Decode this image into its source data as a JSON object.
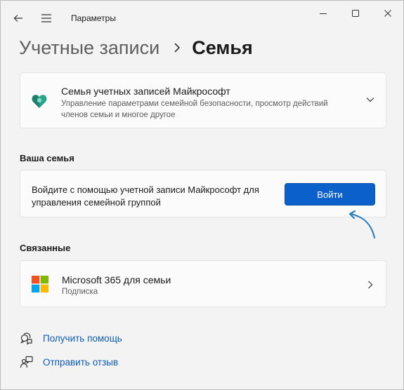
{
  "window": {
    "title": "Параметры"
  },
  "breadcrumb": {
    "parent": "Учетные записи",
    "current": "Семья"
  },
  "family_card": {
    "title": "Семья учетных записей Майкрософт",
    "description": "Управление параметрами семейной безопасности, просмотр действий членов семьи и многое другое"
  },
  "your_family": {
    "heading": "Ваша семья",
    "text": "Войдите с помощью учетной записи Майкрософт для управления семейной группой",
    "button_label": "Войти"
  },
  "related": {
    "heading": "Связанные",
    "items": [
      {
        "title": "Microsoft 365 для семьи",
        "subtitle": "Подписка"
      }
    ]
  },
  "links": {
    "help": "Получить помощь",
    "feedback": "Отправить отзыв"
  },
  "colors": {
    "accent": "#0b60c9",
    "link": "#0b5cb8",
    "family_icon": "#2aa38b",
    "arrow": "#2e7fbf"
  },
  "icons": [
    "back-arrow-icon",
    "hamburger-menu-icon",
    "minimize-icon",
    "maximize-icon",
    "close-icon",
    "chevron-right-icon",
    "family-heart-icon",
    "chevron-down-icon",
    "microsoft-logo-icon",
    "help-icon",
    "feedback-icon"
  ]
}
